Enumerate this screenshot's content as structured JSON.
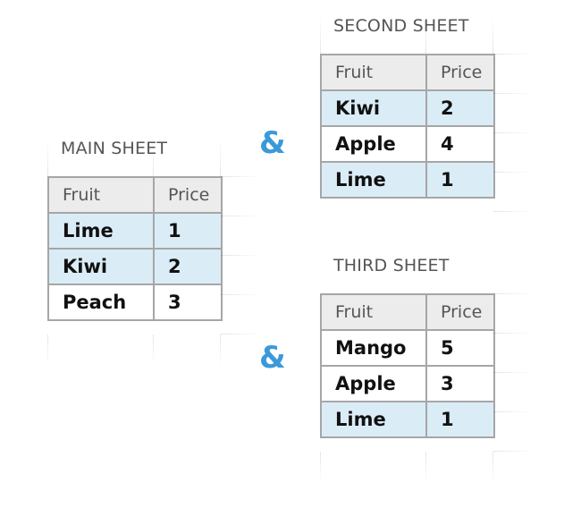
{
  "connector_symbol": "&",
  "colors": {
    "highlight_row": "#daedf7",
    "header_row": "#ececec",
    "border": "#a6a6a6",
    "connector": "#3a9ad9"
  },
  "sheets": {
    "main": {
      "title": "MAIN SHEET",
      "headers": [
        "Fruit",
        "Price"
      ],
      "rows": [
        {
          "fruit": "Lime",
          "price": "1",
          "highlighted": true
        },
        {
          "fruit": "Kiwi",
          "price": "2",
          "highlighted": true
        },
        {
          "fruit": "Peach",
          "price": "3",
          "highlighted": false
        }
      ]
    },
    "second": {
      "title": "SECOND SHEET",
      "headers": [
        "Fruit",
        "Price"
      ],
      "rows": [
        {
          "fruit": "Kiwi",
          "price": "2",
          "highlighted": true
        },
        {
          "fruit": "Apple",
          "price": "4",
          "highlighted": false
        },
        {
          "fruit": "Lime",
          "price": "1",
          "highlighted": true
        }
      ]
    },
    "third": {
      "title": "THIRD SHEET",
      "headers": [
        "Fruit",
        "Price"
      ],
      "rows": [
        {
          "fruit": "Mango",
          "price": "5",
          "highlighted": false
        },
        {
          "fruit": "Apple",
          "price": "3",
          "highlighted": false
        },
        {
          "fruit": "Lime",
          "price": "1",
          "highlighted": true
        }
      ]
    }
  }
}
